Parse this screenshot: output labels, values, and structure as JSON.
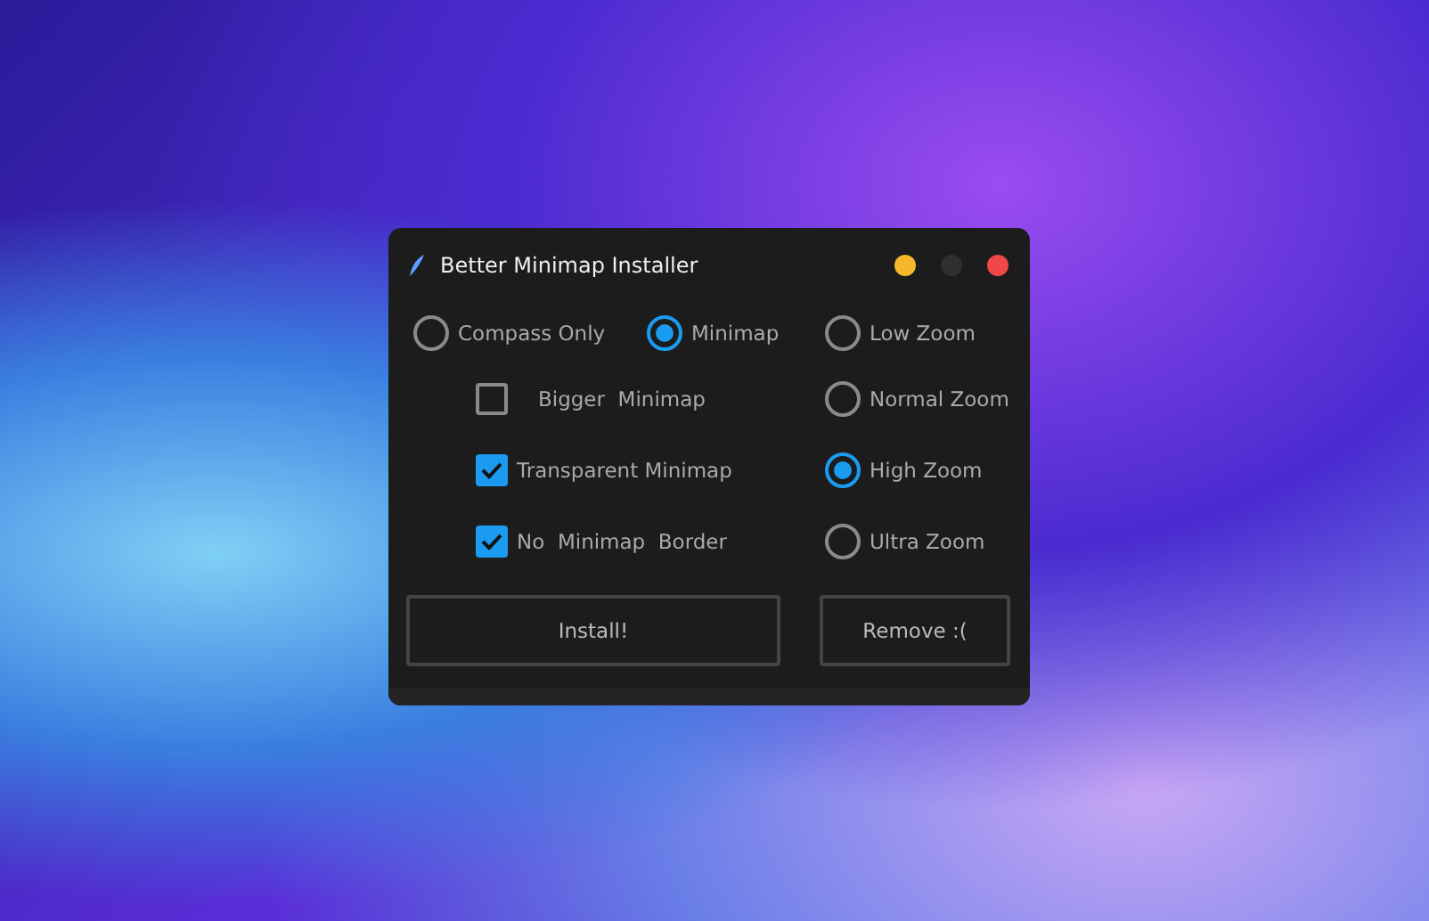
{
  "window": {
    "title": "Better Minimap Installer"
  },
  "modes": [
    {
      "label": "Compass Only",
      "selected": false
    },
    {
      "label": "Minimap",
      "selected": true
    }
  ],
  "options": [
    {
      "label": "Bigger  Minimap",
      "checked": false
    },
    {
      "label": "Transparent Minimap",
      "checked": true
    },
    {
      "label": "No  Minimap  Border",
      "checked": true
    }
  ],
  "zoom_levels": [
    {
      "label": "Low Zoom",
      "selected": false
    },
    {
      "label": "Normal Zoom",
      "selected": false
    },
    {
      "label": "High Zoom",
      "selected": true
    },
    {
      "label": "Ultra Zoom",
      "selected": false
    }
  ],
  "buttons": [
    "Install!",
    "Remove :("
  ]
}
